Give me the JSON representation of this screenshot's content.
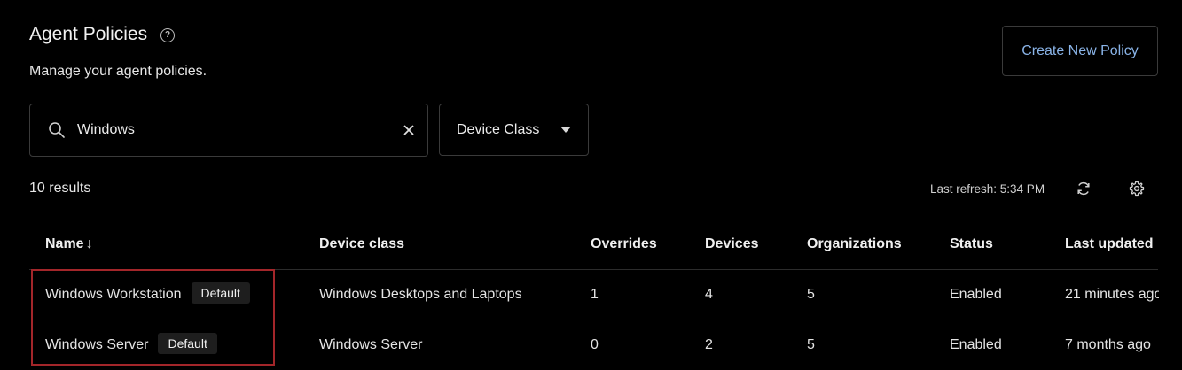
{
  "header": {
    "title": "Agent Policies",
    "subtitle": "Manage your agent policies.",
    "create_button": "Create New Policy"
  },
  "filters": {
    "search_value": "Windows",
    "device_class_label": "Device Class"
  },
  "toolbar": {
    "results": "10 results",
    "last_refresh": "Last refresh: 5:34 PM"
  },
  "table": {
    "columns": {
      "name": "Name",
      "name_sort": "↓",
      "device_class": "Device class",
      "overrides": "Overrides",
      "devices": "Devices",
      "organizations": "Organizations",
      "status": "Status",
      "last_updated": "Last updated"
    },
    "rows": [
      {
        "name": "Windows Workstation",
        "badge": "Default",
        "device_class": "Windows Desktops and Laptops",
        "overrides": "1",
        "devices": "4",
        "organizations": "5",
        "status": "Enabled",
        "last_updated": "21 minutes ago"
      },
      {
        "name": "Windows Server",
        "badge": "Default",
        "device_class": "Windows Server",
        "overrides": "0",
        "devices": "2",
        "organizations": "5",
        "status": "Enabled",
        "last_updated": "7 months ago"
      }
    ]
  },
  "colors": {
    "background": "#000000",
    "accent_link": "#8ab4e8",
    "highlight": "#a3262a",
    "border": "#3a3a3a"
  },
  "icons": [
    "help-icon",
    "search-icon",
    "close-icon",
    "caret-down-icon",
    "refresh-icon",
    "gear-icon",
    "sort-down-icon"
  ]
}
